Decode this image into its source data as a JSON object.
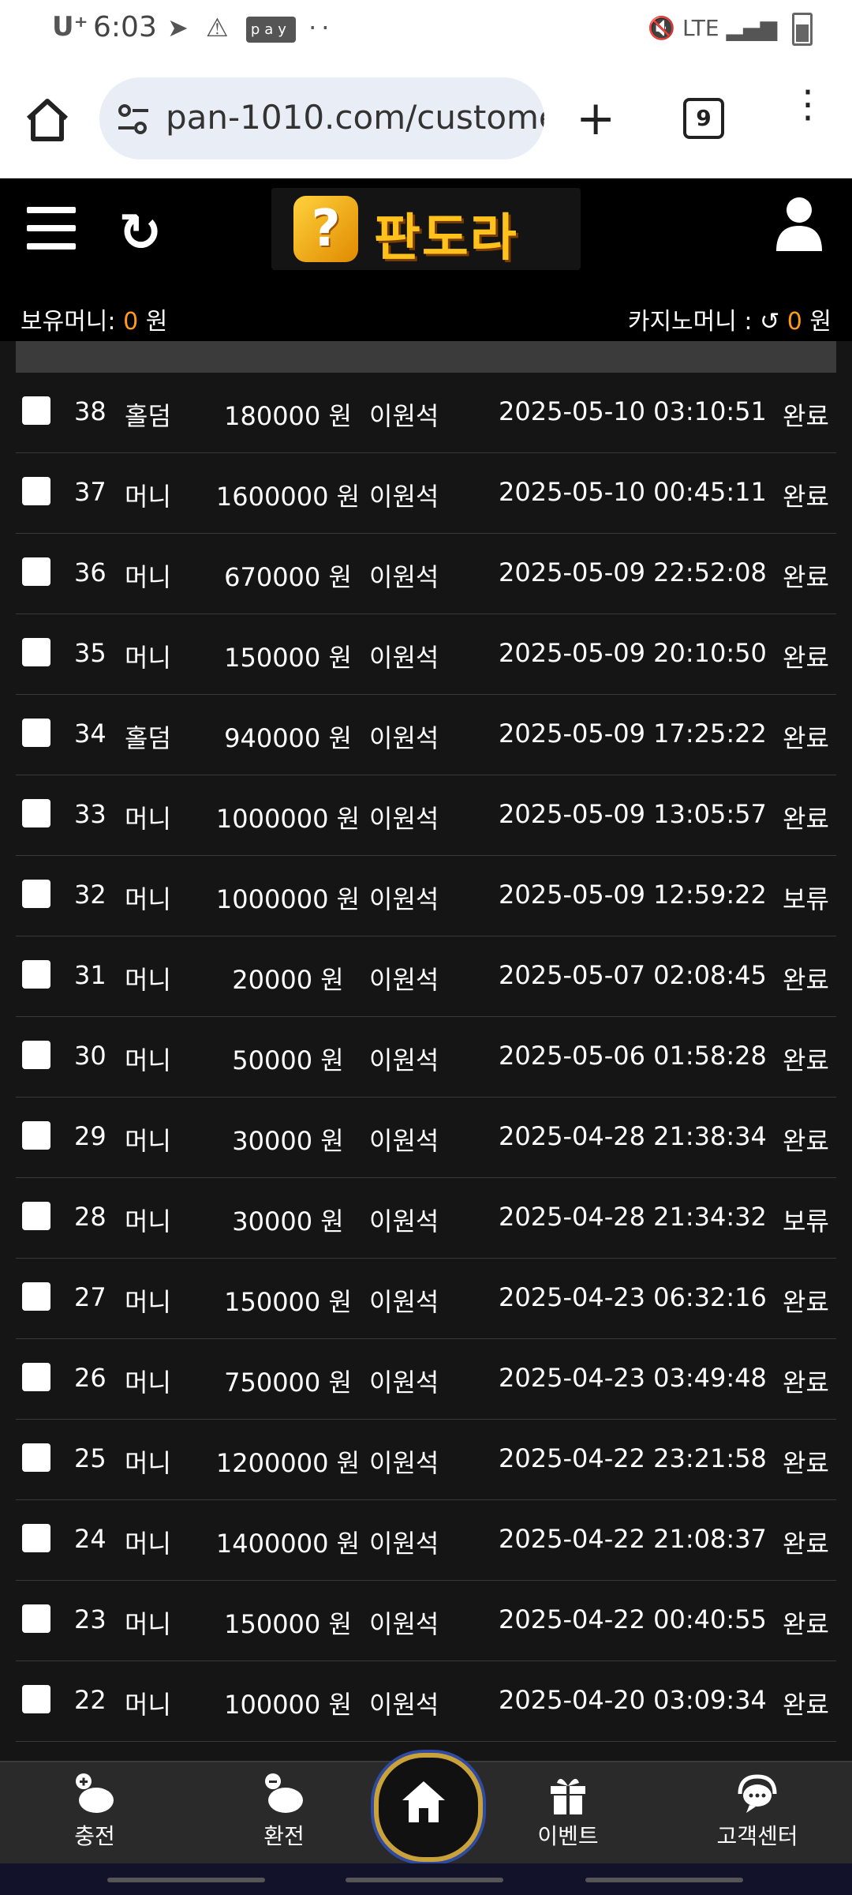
{
  "status_bar": {
    "carrier": "U⁺",
    "time": "6:03",
    "pay_label": "pay",
    "network": "LTE"
  },
  "browser": {
    "url": "pan-1010.com/custome",
    "tab_count": "9"
  },
  "site": {
    "logo_text": "판도라",
    "logo_mark": "?",
    "money_label": "보유머니:",
    "money_value": "0",
    "money_unit": "원",
    "casino_label": "카지노머니 :",
    "casino_value": "0",
    "casino_unit": "원"
  },
  "rows": [
    {
      "num": "38",
      "type": "홀덤",
      "amount": "180000 원",
      "name": "이원석",
      "date": "2025-05-10 03:10:51",
      "status": "완료"
    },
    {
      "num": "37",
      "type": "머니",
      "amount": "1600000 원",
      "name": "이원석",
      "date": "2025-05-10 00:45:11",
      "status": "완료"
    },
    {
      "num": "36",
      "type": "머니",
      "amount": "670000 원",
      "name": "이원석",
      "date": "2025-05-09 22:52:08",
      "status": "완료"
    },
    {
      "num": "35",
      "type": "머니",
      "amount": "150000 원",
      "name": "이원석",
      "date": "2025-05-09 20:10:50",
      "status": "완료"
    },
    {
      "num": "34",
      "type": "홀덤",
      "amount": "940000 원",
      "name": "이원석",
      "date": "2025-05-09 17:25:22",
      "status": "완료"
    },
    {
      "num": "33",
      "type": "머니",
      "amount": "1000000 원",
      "name": "이원석",
      "date": "2025-05-09 13:05:57",
      "status": "완료"
    },
    {
      "num": "32",
      "type": "머니",
      "amount": "1000000 원",
      "name": "이원석",
      "date": "2025-05-09 12:59:22",
      "status": "보류"
    },
    {
      "num": "31",
      "type": "머니",
      "amount": "20000 원",
      "name": "이원석",
      "date": "2025-05-07 02:08:45",
      "status": "완료"
    },
    {
      "num": "30",
      "type": "머니",
      "amount": "50000 원",
      "name": "이원석",
      "date": "2025-05-06 01:58:28",
      "status": "완료"
    },
    {
      "num": "29",
      "type": "머니",
      "amount": "30000 원",
      "name": "이원석",
      "date": "2025-04-28 21:38:34",
      "status": "완료"
    },
    {
      "num": "28",
      "type": "머니",
      "amount": "30000 원",
      "name": "이원석",
      "date": "2025-04-28 21:34:32",
      "status": "보류"
    },
    {
      "num": "27",
      "type": "머니",
      "amount": "150000 원",
      "name": "이원석",
      "date": "2025-04-23 06:32:16",
      "status": "완료"
    },
    {
      "num": "26",
      "type": "머니",
      "amount": "750000 원",
      "name": "이원석",
      "date": "2025-04-23 03:49:48",
      "status": "완료"
    },
    {
      "num": "25",
      "type": "머니",
      "amount": "1200000 원",
      "name": "이원석",
      "date": "2025-04-22 23:21:58",
      "status": "완료"
    },
    {
      "num": "24",
      "type": "머니",
      "amount": "1400000 원",
      "name": "이원석",
      "date": "2025-04-22 21:08:37",
      "status": "완료"
    },
    {
      "num": "23",
      "type": "머니",
      "amount": "150000 원",
      "name": "이원석",
      "date": "2025-04-22 00:40:55",
      "status": "완료"
    },
    {
      "num": "22",
      "type": "머니",
      "amount": "100000 원",
      "name": "이원석",
      "date": "2025-04-20 03:09:34",
      "status": "완료"
    }
  ],
  "bottom_nav": {
    "charge": "충전",
    "exchange": "환전",
    "event": "이벤트",
    "support": "고객센터"
  },
  "colors": {
    "accent": "#ff9a1a",
    "background": "#151515",
    "header": "#000000"
  }
}
